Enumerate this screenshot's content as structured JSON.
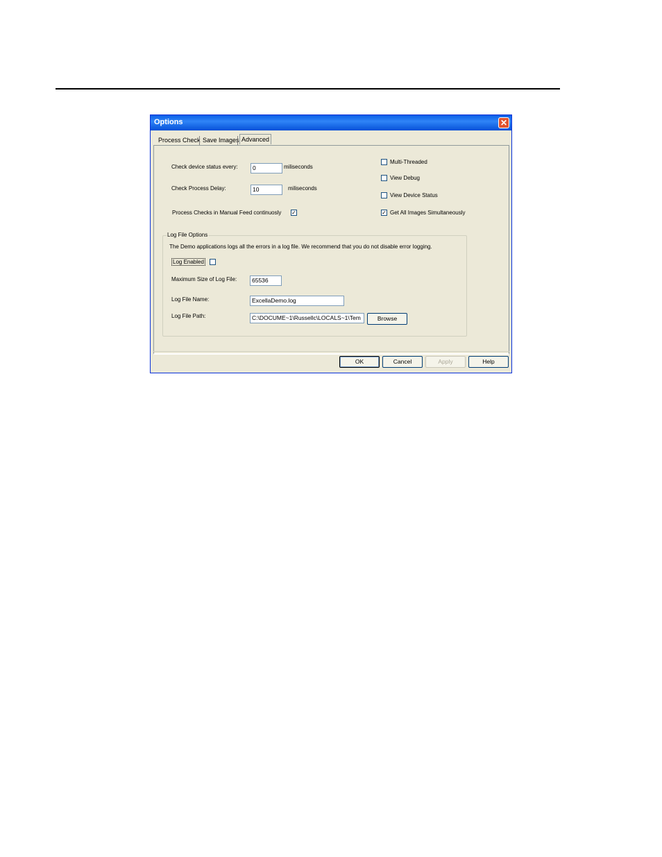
{
  "dialog": {
    "title": "Options",
    "close_glyph": "✕"
  },
  "tabs": [
    {
      "label": "Process Check",
      "active": false
    },
    {
      "label": "Save Images",
      "active": false
    },
    {
      "label": "Advanced",
      "active": true
    }
  ],
  "advanced": {
    "check_device_status_label": "Check device status every:",
    "check_device_status_value": "0",
    "check_device_status_unit": "miliseconds",
    "check_process_delay_label": "Check Process Delay:",
    "check_process_delay_value": "10",
    "check_process_delay_unit": "miliseconds",
    "manual_feed_label": "Process Checks in Manual Feed continuosly",
    "manual_feed_checked": "✓",
    "multi_threaded_label": "Multi-Threaded",
    "multi_threaded_checked": "",
    "view_debug_label": "View Debug",
    "view_debug_checked": "",
    "view_device_status_label": "View Device Status",
    "view_device_status_checked": "",
    "get_all_images_label": "Get All Images Simultaneously",
    "get_all_images_checked": "✓"
  },
  "log_options": {
    "group_title": "Log File Options",
    "description": "The Demo applications logs all the errors in a log file.  We recommend that you do not disable error logging.",
    "log_enabled_label": "Log Enabled",
    "log_enabled_checked": "",
    "max_size_label": "Maximum Size of Log File:",
    "max_size_value": "65536",
    "file_name_label": "Log File Name:",
    "file_name_value": "ExcellaDemo.log",
    "file_path_label": "Log File Path:",
    "file_path_value": "C:\\DOCUME~1\\Russellc\\LOCALS~1\\Tem",
    "browse_label": "Browse"
  },
  "buttons": {
    "ok": "OK",
    "cancel": "Cancel",
    "apply": "Apply",
    "help": "Help"
  }
}
